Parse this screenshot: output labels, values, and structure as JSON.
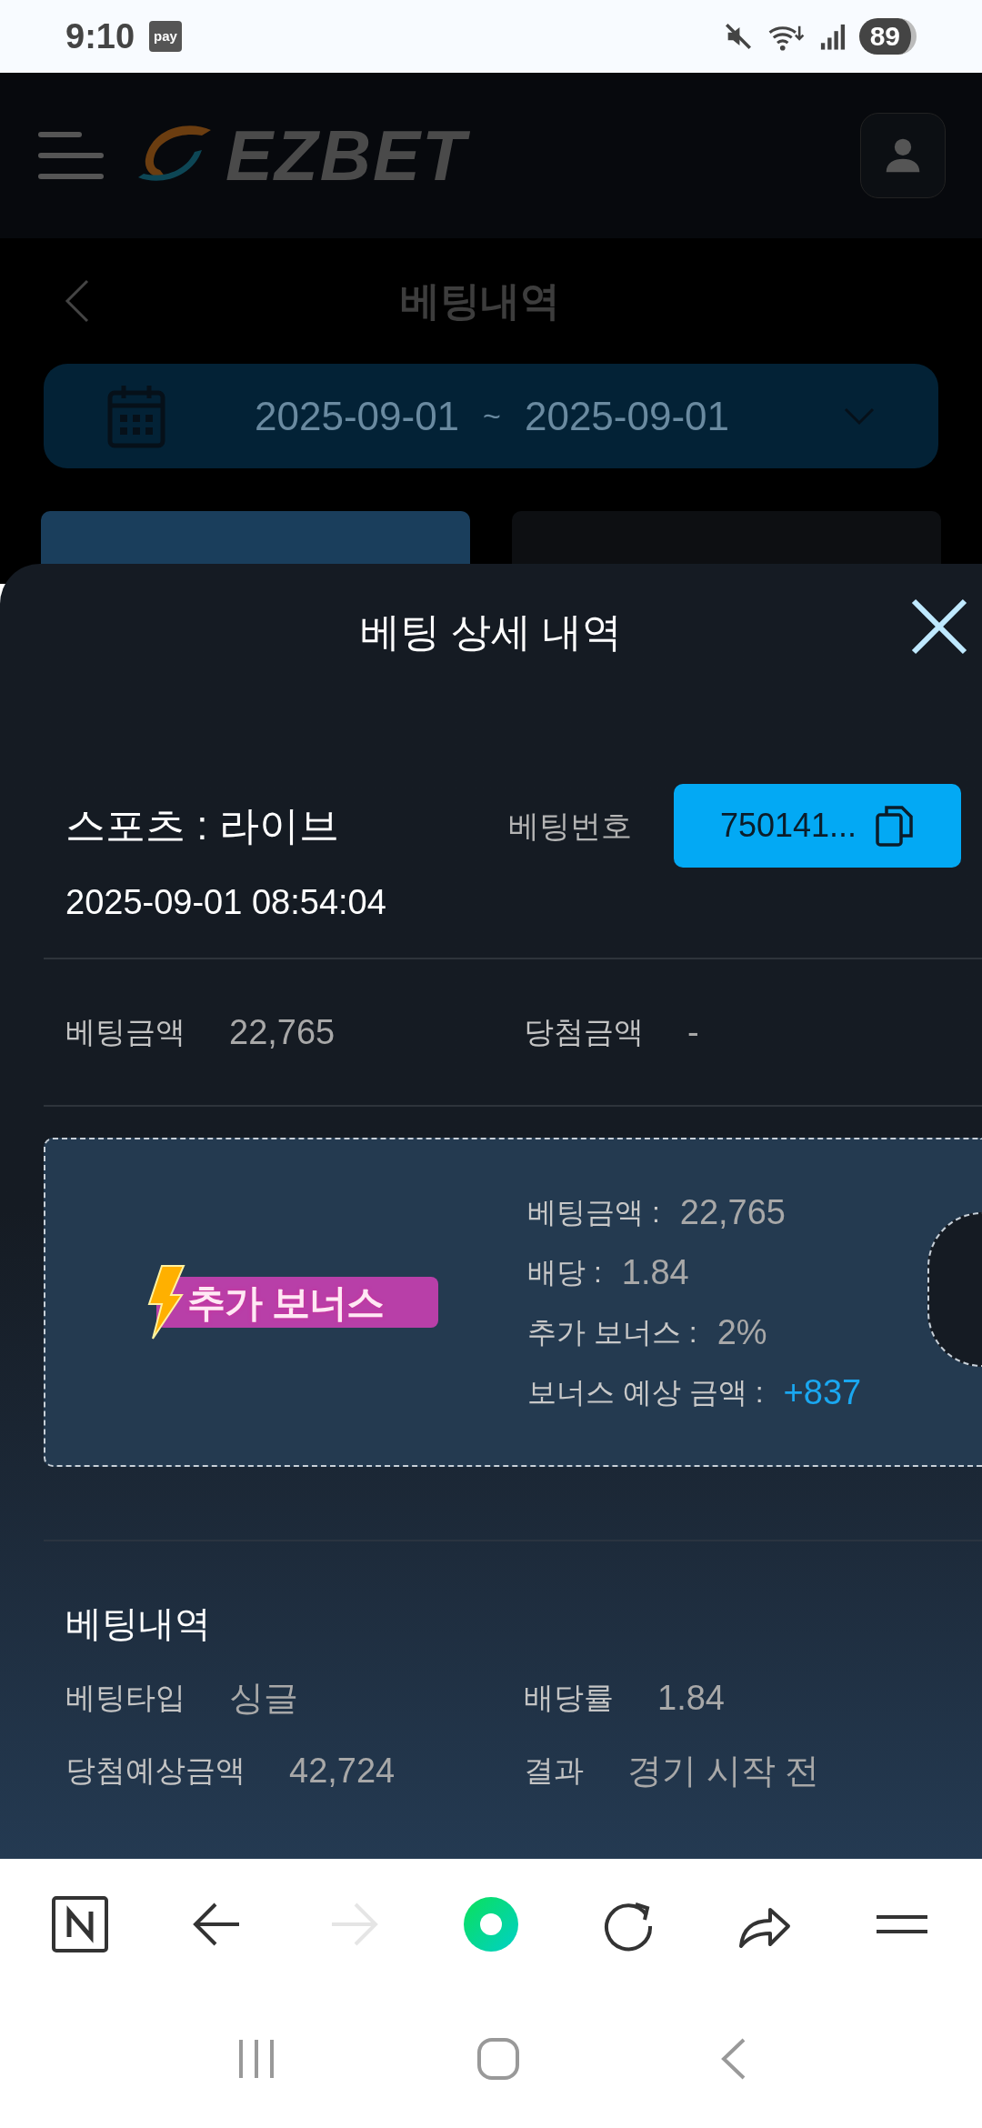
{
  "status_bar": {
    "time": "9:10",
    "pay_badge": "pay",
    "battery": "89"
  },
  "header": {
    "logo": "EZBET"
  },
  "page": {
    "title": "베팅내역",
    "date_from": "2025-09-01",
    "date_separator": "~",
    "date_to": "2025-09-01",
    "tabs": [
      {
        "selected": true
      },
      {
        "selected": false
      }
    ]
  },
  "sheet": {
    "title": "베팅 상세 내역",
    "category": "스포츠 : 라이브",
    "bet_number_label": "베팅번호",
    "bet_number": "750141...",
    "datetime": "2025-09-01 08:54:04",
    "summary": [
      {
        "label": "베팅금액",
        "value": "22,765"
      },
      {
        "label": "당첨금액",
        "value": "-"
      }
    ],
    "bonus": {
      "badge": "추가 보너스",
      "lines": [
        {
          "label": "베팅금액 :",
          "value": "22,765",
          "highlight": false
        },
        {
          "label": "배당 :",
          "value": "1.84",
          "highlight": false
        },
        {
          "label": "추가 보너스 :",
          "value": "2%",
          "highlight": false
        },
        {
          "label": "보너스 예상 금액 :",
          "value": "+837",
          "highlight": true
        }
      ]
    },
    "details": {
      "title": "베팅내역",
      "items": [
        {
          "label": "베팅타입",
          "value": "싱글"
        },
        {
          "label": "배당률",
          "value": "1.84"
        },
        {
          "label": "당첨예상금액",
          "value": "42,724"
        },
        {
          "label": "결과",
          "value": "경기 시작 전"
        }
      ]
    }
  },
  "browser_toolbar": [
    {
      "kind": "home",
      "disabled": false
    },
    {
      "kind": "back",
      "disabled": false
    },
    {
      "kind": "forward",
      "disabled": true
    },
    {
      "kind": "green",
      "disabled": false
    },
    {
      "kind": "reload",
      "disabled": false
    },
    {
      "kind": "share",
      "disabled": false
    },
    {
      "kind": "menu",
      "disabled": false
    }
  ]
}
